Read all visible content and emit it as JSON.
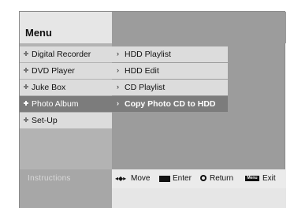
{
  "menu": {
    "title": "Menu"
  },
  "left_menu": {
    "items": [
      {
        "label": "Digital Recorder"
      },
      {
        "label": "DVD Player"
      },
      {
        "label": "Juke Box"
      },
      {
        "label": "Photo Album",
        "selected": true
      },
      {
        "label": "Set-Up"
      }
    ]
  },
  "sub_menu": {
    "items": [
      {
        "label": "HDD Playlist"
      },
      {
        "label": "HDD Edit"
      },
      {
        "label": "CD Playlist"
      },
      {
        "label": "Copy Photo CD to HDD",
        "selected": true
      }
    ]
  },
  "instructions": {
    "label": "Instructions",
    "move_keys": "◂◆▸",
    "move": "Move",
    "enter": "Enter",
    "return": "Return",
    "menu_key": "Menu",
    "exit": "Exit"
  },
  "colors": {
    "selected_bg": "#7c7c7c",
    "item_bg": "#dcdcdc",
    "panel_bg": "#9c9c9c"
  }
}
